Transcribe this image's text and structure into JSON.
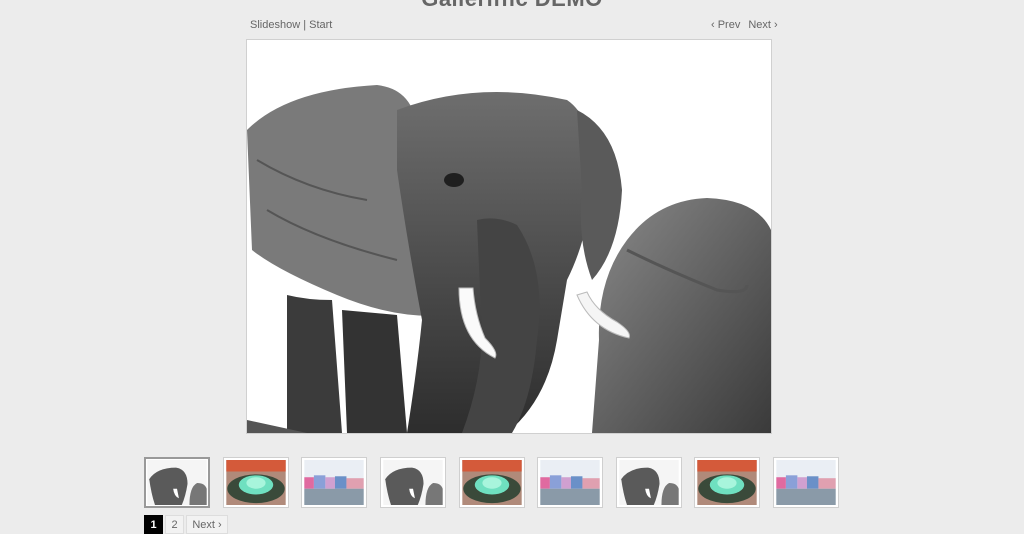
{
  "page": {
    "title": "Galleriffic DEMO"
  },
  "slideshow_controls": {
    "slideshow_label": "Slideshow",
    "separator": "|",
    "start_label": "Start"
  },
  "nav": {
    "prev_label": "‹ Prev",
    "next_label": "Next ›"
  },
  "thumbnails": [
    {
      "subject": "elephants",
      "selected": true
    },
    {
      "subject": "succulent"
    },
    {
      "subject": "colorful-houses"
    },
    {
      "subject": "elephants"
    },
    {
      "subject": "succulent"
    },
    {
      "subject": "colorful-houses"
    },
    {
      "subject": "elephants"
    },
    {
      "subject": "succulent"
    },
    {
      "subject": "colorful-houses"
    }
  ],
  "pagination": {
    "pages": [
      "1",
      "2"
    ],
    "current": "1",
    "next_label": "Next ›"
  },
  "colors": {
    "background": "#ececec",
    "current_page_bg": "#000000",
    "text": "#666666"
  }
}
